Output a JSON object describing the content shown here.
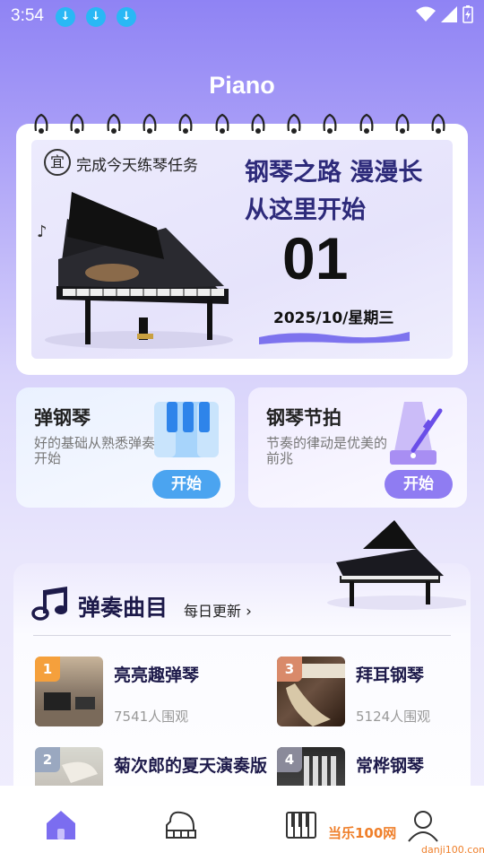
{
  "status_bar": {
    "time": "3:54",
    "download_icons": [
      "download-icon",
      "download-icon",
      "download-icon"
    ],
    "right_icons": [
      "wifi-icon",
      "signal-icon",
      "battery-charging-icon"
    ]
  },
  "header": {
    "title": "Piano"
  },
  "calendar": {
    "yi": "宜",
    "task": "完成今天练琴任务",
    "slogan_line1": "钢琴之路 漫漫长",
    "slogan_line2": "从这里开始",
    "day": "01",
    "date": "2025/10/星期三"
  },
  "features": [
    {
      "title": "弹钢琴",
      "desc": "好的基础从熟悉弹奏开始",
      "button": "开始",
      "icon": "piano-keys-icon"
    },
    {
      "title": "钢琴节拍",
      "desc": "节奏的律动是优美的前兆",
      "button": "开始",
      "icon": "metronome-icon"
    }
  ],
  "songs": {
    "title": "弹奏曲目",
    "daily_update": "每日更新",
    "items": [
      {
        "rank": "1",
        "name": "亮亮趣弹琴",
        "views": "7541人围观",
        "rank_color": "#f5a03c"
      },
      {
        "rank": "3",
        "name": "拜耳钢琴",
        "views": "5124人围观",
        "rank_color": "#d98a6a"
      },
      {
        "rank": "2",
        "name": "菊次郎的夏天演奏版",
        "views": "",
        "rank_color": "#9aa8c0"
      },
      {
        "rank": "4",
        "name": "常桦钢琴",
        "views": "",
        "rank_color": "#8a8a9a"
      }
    ]
  },
  "nav": {
    "items": [
      "home-icon",
      "piano-icon",
      "keyboard-icon",
      "user-icon"
    ],
    "active_color": "#7b6df0"
  },
  "watermark": {
    "text1": "当乐100网",
    "text2": "danji100.com"
  }
}
